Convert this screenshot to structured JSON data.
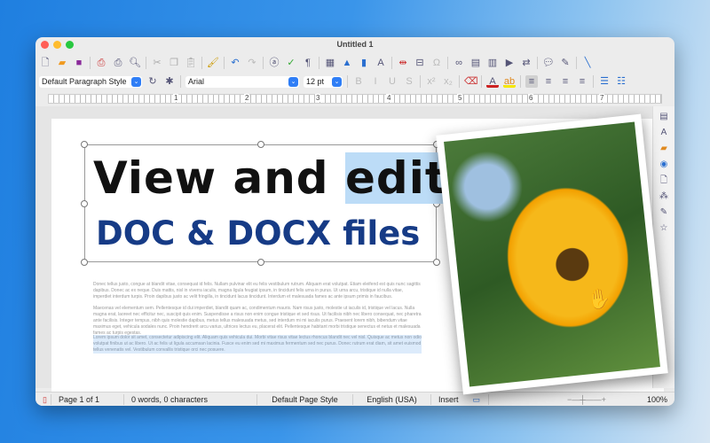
{
  "window": {
    "title": "Untitled 1"
  },
  "toolbar": {
    "paragraph_style": "Default Paragraph Style",
    "font_name": "Arial",
    "font_size": "12 pt",
    "font_color": "#cc2222",
    "highlight_color": "#f5e600"
  },
  "ruler": {
    "marks": [
      "1",
      "2",
      "3",
      "4",
      "5",
      "6",
      "7"
    ]
  },
  "document": {
    "heading_line1_plain": "View and ",
    "heading_line1_selected": "edit",
    "heading_line2": "DOC & DOCX files",
    "paragraphs": [
      "Donec tellus justo, congue at blandit vitae, consequat id felis. Nullam pulvinar elit eu felis vestibulum rutrum. Aliquam erat volutpat. Etiam eleifend est quis nunc sagittis dapibus. Donec ac ex neque. Duis mattis, nisl in viverra iaculis, magna ligula feugiat ipsum, in tincidunt felis urna in purus. Ut urna arcu, tristique id nulla vitae, imperdiet interdum turpis. Proin dapibus justo ac velit fringilla, in tincidunt lacus tincidunt. Interdum et malesuada fames ac ante ipsum primis in faucibus.",
      "Maecenas vel elementum sem. Pellentesque id dui imperdiet, blandit quam ac, condimentum mauris. Nam risus justo, molestie ut iaculis id, tristique vel lacus. Nulla magna erat, laoreet nec efficitur nec, suscipit quis enim. Suspendisse a risus non enim congue tristique et sed risus. Ut facilisis nibh nec libero consequat, nec pharetra ante facilisis. Integer tempus, nibh quis molestie dapibus, metus tellus malesuada metus, sed interdum mi mi iaculis purus. Praesent lorem nibh, bibendum vitae maximus eget, vehicula sodales nunc. Proin hendrerit arcu varius, ultrices lectus eu, placerat elit. Pellentesque habitant morbi tristique senectus et netus et malesuada fames ac turpis egestas.",
      "Lorem ipsum dolor sit amet, consectetur adipiscing elit. Aliquam quis vehicula dui. Morbi vitae risus vitae lectus rhoncus blandit nec vel nisl. Quisque ac metus non odio volutpat finibus ut ac libero. Ut ac felis ut ligula accumsan lacinia. Fusce eu enim sed mi maximus fermentum sed nec purus. Donec rutrum erat diam, sit amet euismod tellus venenatis vel. Vestibulum convallis tristique orci nec posuere."
    ]
  },
  "status": {
    "page": "Page 1 of 1",
    "words": "0 words, 0 characters",
    "page_style": "Default Page Style",
    "language": "English (USA)",
    "mode": "Insert",
    "zoom": "100%"
  },
  "zoom_level_percent": 100
}
